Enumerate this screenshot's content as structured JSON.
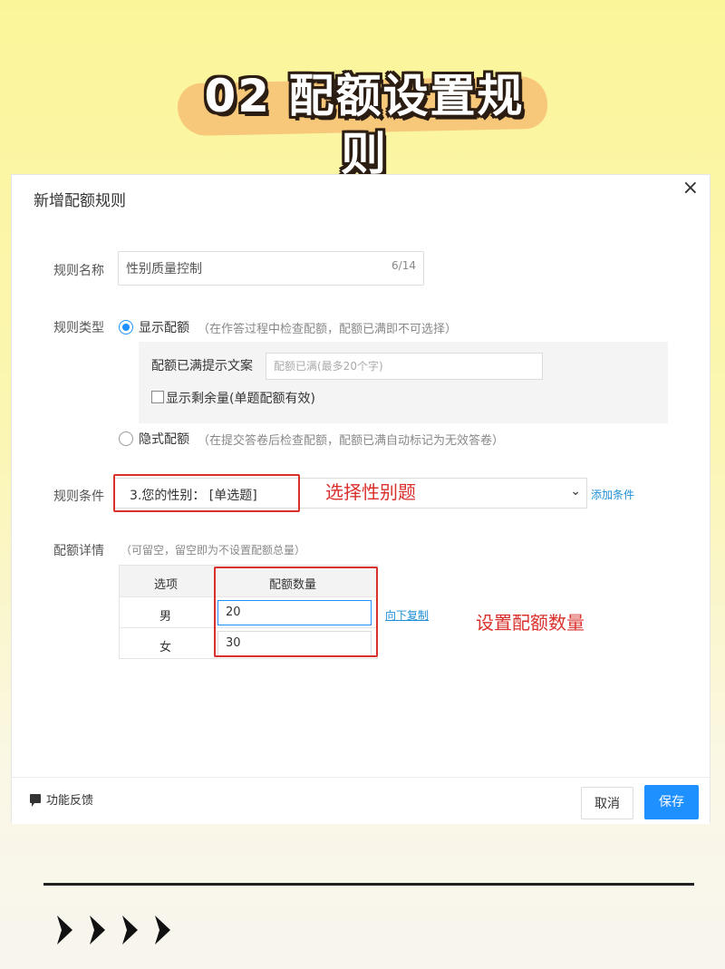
{
  "banner": {
    "title": "02 配额设置规则"
  },
  "dialog": {
    "title": "新增配额规则",
    "close_icon": "×",
    "rule_name": {
      "label": "规则名称",
      "value": "性别质量控制",
      "counter": "6/14"
    },
    "rule_type": {
      "label": "规则类型",
      "option_show": {
        "label": "显示配额",
        "hint": "（在作答过程中检查配额，配额已满即不可选择）",
        "checked": true
      },
      "full_text_label": "配额已满提示文案",
      "full_text_placeholder": "配额已满(最多20个字)",
      "show_remaining_label": "显示剩余量(单题配额有效)",
      "option_hidden": {
        "label": "隐式配额",
        "hint": "（在提交答卷后检查配额，配额已满自动标记为无效答卷）",
        "checked": false
      }
    },
    "rule_condition": {
      "label": "规则条件",
      "selected": "3.您的性别：  [单选题]",
      "arrow": "⌄",
      "add_link": "添加条件",
      "annotation": "选择性别题"
    },
    "quota_detail": {
      "label": "配额详情",
      "hint": "（可留空，留空即为不设置配额总量）",
      "columns": [
        "选项",
        "配额数量"
      ],
      "rows": [
        {
          "option": "男",
          "quantity": "20"
        },
        {
          "option": "女",
          "quantity": "30"
        }
      ],
      "copy_down_link": "向下复制",
      "annotation": "设置配额数量"
    },
    "footer": {
      "feedback_label": "功能反馈",
      "cancel_label": "取消",
      "save_label": "保存"
    }
  },
  "colors": {
    "accent": "#1e90ff",
    "annotation": "#d9302c",
    "background": "#fbf59a",
    "banner_blob": "#f7c77a"
  }
}
